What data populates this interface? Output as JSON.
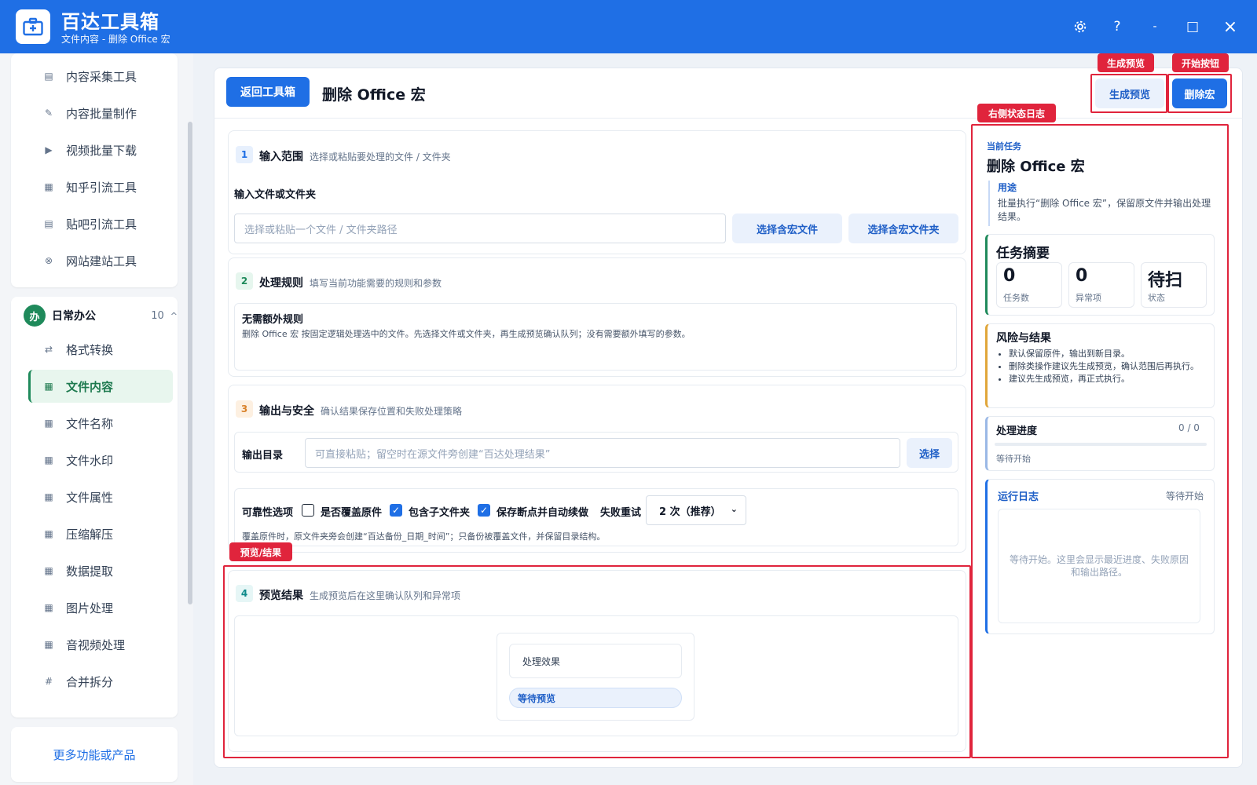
{
  "app": {
    "title": "百达工具箱",
    "subtitle": "文件内容 - 删除 Office 宏",
    "settings_icon": "gear-icon",
    "help_label": "?",
    "minimize_label": "-",
    "maximize_label": "□",
    "close_label": "×"
  },
  "sidebar": {
    "top_items": [
      {
        "icon": "▤",
        "label": "内容采集工具"
      },
      {
        "icon": "✎",
        "label": "内容批量制作"
      },
      {
        "icon": "▶",
        "label": "视频批量下载"
      },
      {
        "icon": "▦",
        "label": "知乎引流工具"
      },
      {
        "icon": "▤",
        "label": "贴吧引流工具"
      },
      {
        "icon": "⊗",
        "label": "网站建站工具"
      }
    ],
    "group": {
      "badge": "办",
      "label": "日常办公",
      "count": "10",
      "chevron": "^"
    },
    "group_items": [
      {
        "icon": "⇄",
        "label": "格式转换"
      },
      {
        "icon": "▦",
        "label": "文件内容",
        "active": true
      },
      {
        "icon": "▦",
        "label": "文件名称"
      },
      {
        "icon": "▦",
        "label": "文件水印"
      },
      {
        "icon": "▦",
        "label": "文件属性"
      },
      {
        "icon": "▦",
        "label": "压缩解压"
      },
      {
        "icon": "▦",
        "label": "数据提取"
      },
      {
        "icon": "▦",
        "label": "图片处理"
      },
      {
        "icon": "▦",
        "label": "音视频处理"
      },
      {
        "icon": "#",
        "label": "合并拆分"
      }
    ],
    "more_label": "更多功能或产品"
  },
  "header": {
    "back_label": "返回工具箱",
    "page_title": "删除 Office 宏",
    "preview_label": "生成预览",
    "run_label": "删除宏"
  },
  "sections": {
    "input": {
      "num": "1",
      "title": "输入范围",
      "desc": "选择或粘贴要处理的文件 / 文件夹",
      "field_label": "输入文件或文件夹",
      "placeholder": "选择或粘贴一个文件 / 文件夹路径",
      "btn_file": "选择含宏文件",
      "btn_folder": "选择含宏文件夹"
    },
    "rules": {
      "num": "2",
      "title": "处理规则",
      "desc": "填写当前功能需要的规则和参数",
      "box_title": "无需额外规则",
      "box_desc": "删除 Office 宏 按固定逻辑处理选中的文件。先选择文件或文件夹，再生成预览确认队列；没有需要额外填写的参数。"
    },
    "output": {
      "num": "3",
      "title": "输出与安全",
      "desc": "确认结果保存位置和失败处理策略",
      "dir_label": "输出目录",
      "dir_placeholder": "可直接粘贴；留空时在源文件旁创建“百达处理结果”",
      "choose_label": "选择",
      "reliability_label": "可靠性选项",
      "overwrite_label": "是否覆盖原件",
      "overwrite_checked": false,
      "subfolder_label": "包含子文件夹",
      "subfolder_checked": true,
      "resume_label": "保存断点并自动续做",
      "resume_checked": true,
      "retry_label": "失败重试",
      "retry_value": "2 次（推荐）",
      "note": "覆盖原件时，原文件夹旁会创建“百达备份_日期_时间”；只备份被覆盖文件，并保留目录结构。"
    },
    "preview": {
      "num": "4",
      "title": "预览结果",
      "desc": "生成预览后在这里确认队列和异常项",
      "effect_label": "处理效果",
      "status_label": "等待预览"
    }
  },
  "right_panel": {
    "current_label": "当前任务",
    "task_title": "删除 Office 宏",
    "usage_label": "用途",
    "usage_text": "批量执行“删除 Office 宏”，保留原文件并输出处理结果。",
    "summary_title": "任务摘要",
    "stats": [
      {
        "value": "0",
        "label": "任务数"
      },
      {
        "value": "0",
        "label": "异常项"
      },
      {
        "value": "待扫",
        "label": "状态"
      }
    ],
    "risk_title": "风险与结果",
    "risk_items": [
      "默认保留原件，输出到新目录。",
      "删除类操作建议先生成预览，确认范围后再执行。",
      "建议先生成预览，再正式执行。"
    ],
    "progress_title": "处理进度",
    "progress_count": "0 / 0",
    "progress_fraction": 0,
    "progress_status": "等待开始",
    "log_title": "运行日志",
    "log_status": "等待开始",
    "log_placeholder": "等待开始。这里会显示最近进度、失败原因和输出路径。"
  },
  "annotations": {
    "preview_tag": "生成预览",
    "run_tag": "开始按钮",
    "status_log_tag": "右侧状态日志",
    "result_tag": "预览/结果"
  }
}
